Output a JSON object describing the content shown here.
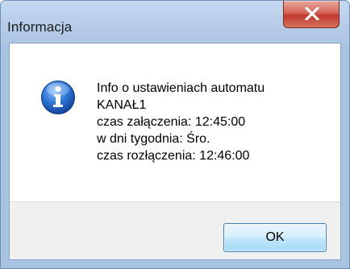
{
  "window": {
    "title": "Informacja"
  },
  "message": {
    "icon": "info-icon",
    "lines": [
      "Info o ustawieniach automatu",
      "KANAŁ1",
      "czas załączenia: 12:45:00",
      "w dni tygodnia: Śro.",
      "czas rozłączenia: 12:46:00"
    ]
  },
  "buttons": {
    "ok_label": "OK",
    "close_icon": "close-icon"
  },
  "colors": {
    "close_button": "#c0392b",
    "info_icon": "#1f5fbf",
    "ok_border": "#3c7fb1"
  }
}
